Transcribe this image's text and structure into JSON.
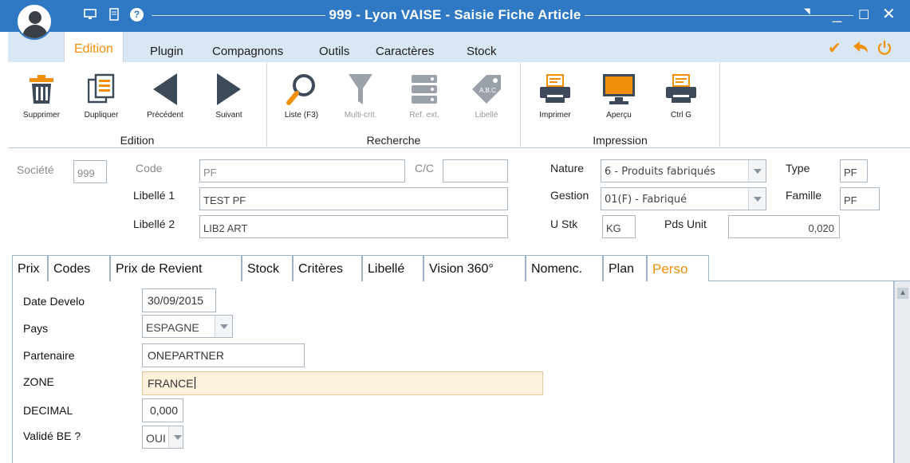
{
  "window": {
    "title": "999 - Lyon VAISE - Saisie Fiche Article"
  },
  "menu": {
    "items": [
      "Edition",
      "Plugin",
      "Compagnons",
      "Outils",
      "Caractères",
      "Stock"
    ],
    "active": "Edition"
  },
  "ribbon": {
    "groups": [
      {
        "label": "Edition",
        "buttons": [
          {
            "label": "Supprimer",
            "icon": "trash-icon"
          },
          {
            "label": "Dupliquer",
            "icon": "duplicate-icon"
          },
          {
            "label": "Précédent",
            "icon": "arrow-left-icon"
          },
          {
            "label": "Suivant",
            "icon": "arrow-right-icon"
          }
        ]
      },
      {
        "label": "Recherche",
        "buttons": [
          {
            "label": "Liste (F3)",
            "icon": "search-icon"
          },
          {
            "label": "Multi-crit.",
            "icon": "filter-icon"
          },
          {
            "label": "Ref. ext.",
            "icon": "database-icon"
          },
          {
            "label": "Libellé",
            "icon": "tag-icon"
          }
        ]
      },
      {
        "label": "Impression",
        "buttons": [
          {
            "label": "Imprimer",
            "icon": "printer-icon"
          },
          {
            "label": "Aperçu",
            "icon": "monitor-icon"
          },
          {
            "label": "Ctrl G",
            "icon": "printer-icon"
          }
        ]
      }
    ]
  },
  "header": {
    "societe_label": "Société",
    "societe_value": "999",
    "code_label": "Code",
    "code_value": "PF",
    "cc_label": "C/C",
    "cc_value": "",
    "libelle1_label": "Libellé 1",
    "libelle1_value": "TEST PF",
    "libelle2_label": "Libellé 2",
    "libelle2_value": "LIB2 ART",
    "nature_label": "Nature",
    "nature_value": "6 - Produits fabriqués",
    "gestion_label": "Gestion",
    "gestion_value": "01(F) - Fabriqué",
    "ustk_label": "U Stk",
    "ustk_value": "KG",
    "pdsunit_label": "Pds Unit",
    "pdsunit_value": "0,020",
    "type_label": "Type",
    "type_value": "PF",
    "famille_label": "Famille",
    "famille_value": "PF"
  },
  "tabs": {
    "items": [
      "Prix",
      "Codes",
      "Prix de Revient",
      "Stock",
      "Critères",
      "Libellé",
      "Vision 360°",
      "Nomenc.",
      "Plan",
      "Perso"
    ],
    "active": "Perso"
  },
  "perso": {
    "date_label": "Date Develo",
    "date_value": "30/09/2015",
    "pays_label": "Pays",
    "pays_value": "ESPAGNE",
    "partenaire_label": "Partenaire",
    "partenaire_value": "ONEPARTNER",
    "zone_label": "ZONE",
    "zone_value": "FRANCE",
    "decimal_label": "DECIMAL",
    "decimal_value": "0,000",
    "valide_label": "Validé BE ?",
    "valide_value": "OUI"
  },
  "colors": {
    "titlebar": "#2f78c4",
    "menubar": "#d9e6f4",
    "accent": "#f0900a",
    "focus_field": "#fdf1dc"
  }
}
